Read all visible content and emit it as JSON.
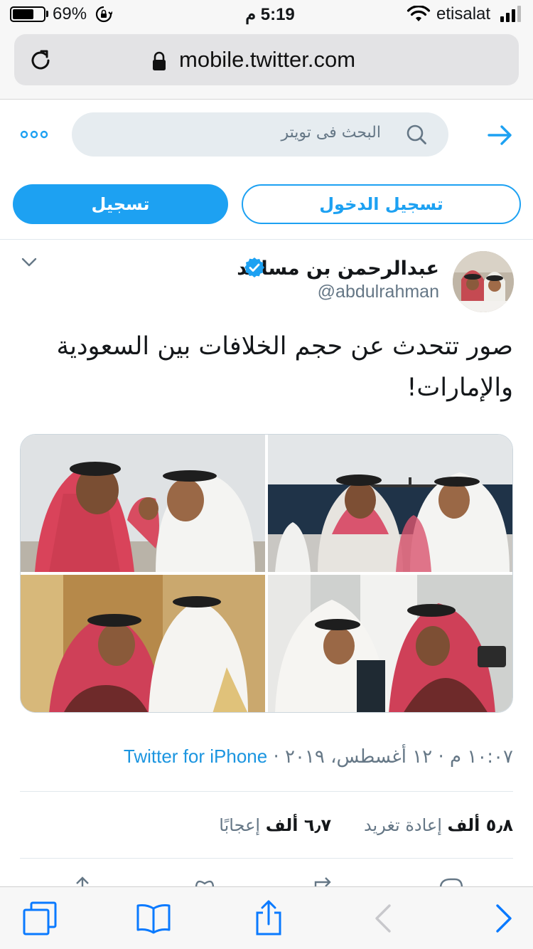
{
  "status_bar": {
    "battery_percent_label": "69%",
    "battery_level": 0.69,
    "time": "5:19 م",
    "carrier": "etisalat"
  },
  "browser": {
    "url": "mobile.twitter.com"
  },
  "twitter_header": {
    "search_placeholder": "البحث فى تويتر",
    "signup_label": "تسجيل",
    "login_label": "تسجيل الدخول"
  },
  "tweet": {
    "author_name": "عبدالرحمن بن مساعد",
    "author_handle": "@abdulrahman",
    "text": "صور تتحدث عن حجم الخلافات بين السعودية والإمارات!",
    "timestamp": "١٠:٠٧ م · ١٢ أغسطس، ٢٠١٩ ·",
    "source": "Twitter for iPhone",
    "retweets_count": "٥٫٨ ألف",
    "retweets_label": "إعادة تغريد",
    "likes_count": "٦٫٧ ألف",
    "likes_label": "إعجابًا"
  },
  "colors": {
    "twitter_blue": "#1da1f2",
    "link_blue": "#1b95e0",
    "muted_text": "#657786",
    "safari_blue": "#0a7aff"
  },
  "icons": {
    "status": [
      "battery-icon",
      "rotation-lock-icon",
      "wifi-icon",
      "signal-icon"
    ],
    "browser": [
      "reload-icon",
      "lock-icon"
    ],
    "toolbar": [
      "tabs-icon",
      "bookmarks-icon",
      "share-icon",
      "back-icon",
      "forward-icon"
    ]
  }
}
